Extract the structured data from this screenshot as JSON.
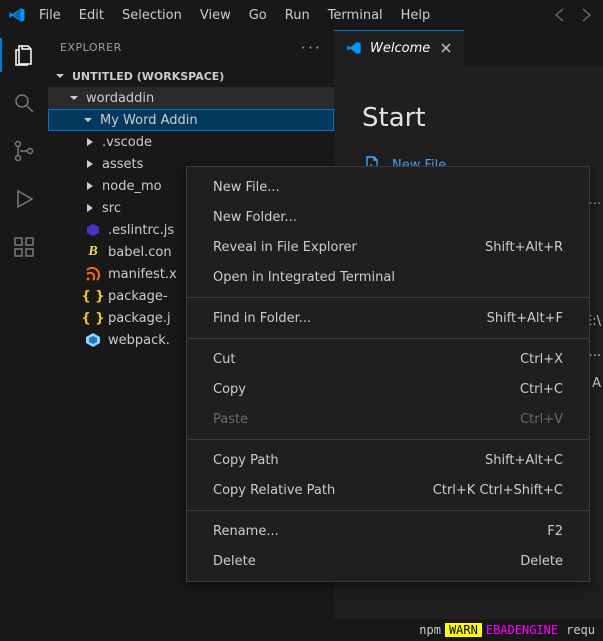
{
  "menubar": {
    "items": [
      "File",
      "Edit",
      "Selection",
      "View",
      "Go",
      "Run",
      "Terminal",
      "Help"
    ]
  },
  "sidebar": {
    "title": "EXPLORER",
    "workspace_label": "UNTITLED (WORKSPACE)",
    "folder_root": "wordaddin",
    "folder_child": "My Word Addin",
    "nodes": [
      {
        "label": ".vscode",
        "icon": "folder"
      },
      {
        "label": "assets",
        "icon": "folder"
      },
      {
        "label": "node_mo",
        "icon": "folder"
      },
      {
        "label": "src",
        "icon": "folder"
      },
      {
        "label": ".eslintrc.js",
        "icon": "eslint"
      },
      {
        "label": "babel.con",
        "icon": "babel"
      },
      {
        "label": "manifest.x",
        "icon": "xml"
      },
      {
        "label": "package-",
        "icon": "json"
      },
      {
        "label": "package.j",
        "icon": "json"
      },
      {
        "label": "webpack.",
        "icon": "webpack"
      }
    ]
  },
  "editor": {
    "tab_label": "Welcome",
    "heading": "Start",
    "new_file_label": "New File",
    "link_extra": "er...",
    "row1": "E:\\",
    "row2": "k:...",
    "row3": "A",
    "row4": "requ"
  },
  "context_menu": {
    "sections": [
      [
        {
          "label": "New File...",
          "shortcut": ""
        },
        {
          "label": "New Folder...",
          "shortcut": ""
        },
        {
          "label": "Reveal in File Explorer",
          "shortcut": "Shift+Alt+R"
        },
        {
          "label": "Open in Integrated Terminal",
          "shortcut": ""
        }
      ],
      [
        {
          "label": "Find in Folder...",
          "shortcut": "Shift+Alt+F"
        }
      ],
      [
        {
          "label": "Cut",
          "shortcut": "Ctrl+X"
        },
        {
          "label": "Copy",
          "shortcut": "Ctrl+C"
        },
        {
          "label": "Paste",
          "shortcut": "Ctrl+V",
          "disabled": true
        }
      ],
      [
        {
          "label": "Copy Path",
          "shortcut": "Shift+Alt+C"
        },
        {
          "label": "Copy Relative Path",
          "shortcut": "Ctrl+K Ctrl+Shift+C"
        }
      ],
      [
        {
          "label": "Rename...",
          "shortcut": "F2"
        },
        {
          "label": "Delete",
          "shortcut": "Delete"
        }
      ]
    ]
  },
  "statusbar": {
    "npm": "npm",
    "warn": "WARN",
    "ebad": "EBADENGINE"
  }
}
